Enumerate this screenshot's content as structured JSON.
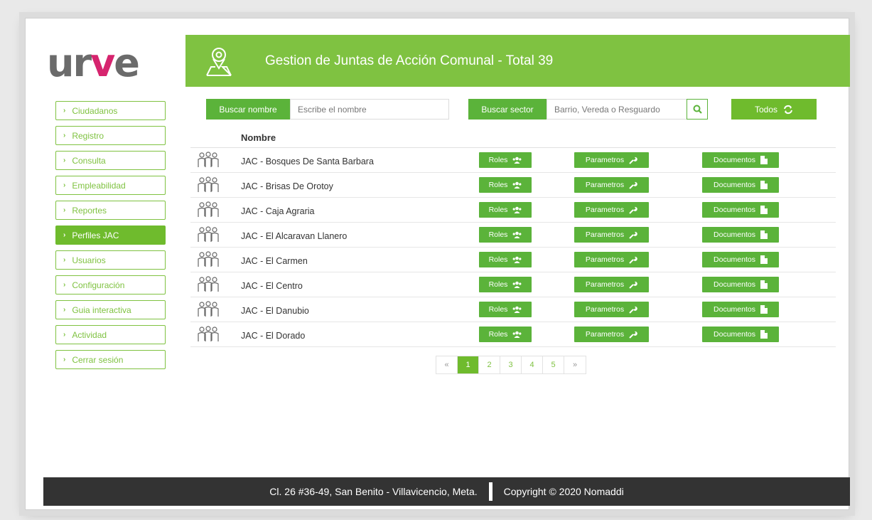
{
  "brand": {
    "logo_text_a": "ur",
    "logo_text_b": "v",
    "logo_text_c": "e",
    "accent_color": "#7fc241",
    "logo_accent_color": "#d6246e"
  },
  "header": {
    "title": "Gestion de Juntas de Acción Comunal - Total 39",
    "icon": "map-pin-icon"
  },
  "sidebar": {
    "items": [
      {
        "label": "Ciudadanos",
        "active": false
      },
      {
        "label": "Registro",
        "active": false
      },
      {
        "label": "Consulta",
        "active": false
      },
      {
        "label": "Empleabilidad",
        "active": false
      },
      {
        "label": "Reportes",
        "active": false
      },
      {
        "label": "Perfiles JAC",
        "active": true
      },
      {
        "label": "Usuarios",
        "active": false
      },
      {
        "label": "Configuración",
        "active": false
      },
      {
        "label": "Guia interactiva",
        "active": false
      },
      {
        "label": "Actividad",
        "active": false
      },
      {
        "label": "Cerrar sesión",
        "active": false
      }
    ]
  },
  "search": {
    "name_label": "Buscar nombre",
    "name_placeholder": "Escribe el nombre",
    "sector_label": "Buscar sector",
    "sector_placeholder": "Barrio, Vereda o Resguardo",
    "todos_label": "Todos"
  },
  "table": {
    "column_name": "Nombre",
    "roles_label": "Roles",
    "params_label": "Parametros",
    "docs_label": "Documentos",
    "rows": [
      "JAC - Bosques De Santa Barbara",
      "JAC - Brisas De Orotoy",
      "JAC - Caja Agraria",
      "JAC - El Alcaravan Llanero",
      "JAC - El Carmen",
      "JAC - El Centro",
      "JAC - El Danubio",
      "JAC - El Dorado"
    ]
  },
  "pagination": {
    "prev": "«",
    "next": "»",
    "pages": [
      "1",
      "2",
      "3",
      "4",
      "5"
    ],
    "current": "1"
  },
  "footer": {
    "address": "Cl. 26 #36-49, San Benito - Villavicencio, Meta.",
    "copyright": "Copyright © 2020 Nomaddi"
  }
}
